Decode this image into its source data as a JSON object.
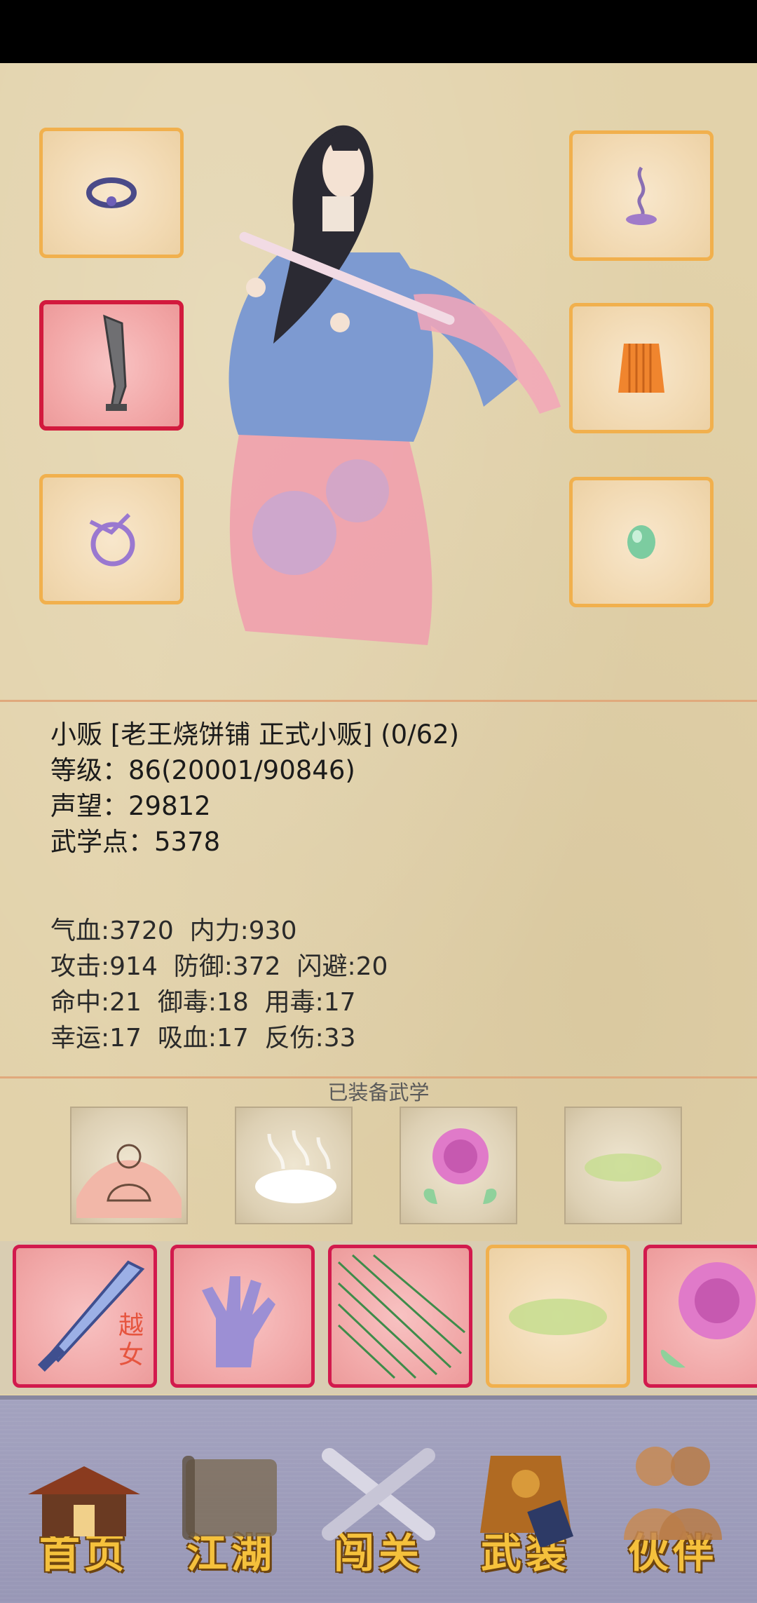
{
  "character": {
    "identity": "小贩 [老王烧饼铺 正式小贩] (0/62)",
    "level": "等级：86(20001/90846)",
    "reputation": "声望：29812",
    "martial_points": "武学点：5378"
  },
  "stats": {
    "line1": "气血:3720  内力:930",
    "line2": "攻击:914  防御:372  闪避:20",
    "line3": "命中:21  御毒:18  用毒:17",
    "line4": "幸运:17  吸血:17  反伤:33"
  },
  "equipped_martial_title": "已装备武学",
  "martial_slot_1_text": "越女",
  "nav": [
    {
      "label": "首页"
    },
    {
      "label": "江湖"
    },
    {
      "label": "闯关"
    },
    {
      "label": "武装"
    },
    {
      "label": "伙伴"
    }
  ],
  "icons": {
    "left_slots": [
      "ring-icon",
      "sword-icon",
      "amulet-icon"
    ],
    "right_slots": [
      "incense-icon",
      "armor-icon",
      "jade-icon"
    ],
    "skills": [
      "meditation-icon",
      "cloud-icon",
      "rose-icon",
      "mist-icon"
    ],
    "martial": [
      "yuenu-sword-icon",
      "palm-icon",
      "needles-icon",
      "mist-icon",
      "rose-icon"
    ]
  }
}
